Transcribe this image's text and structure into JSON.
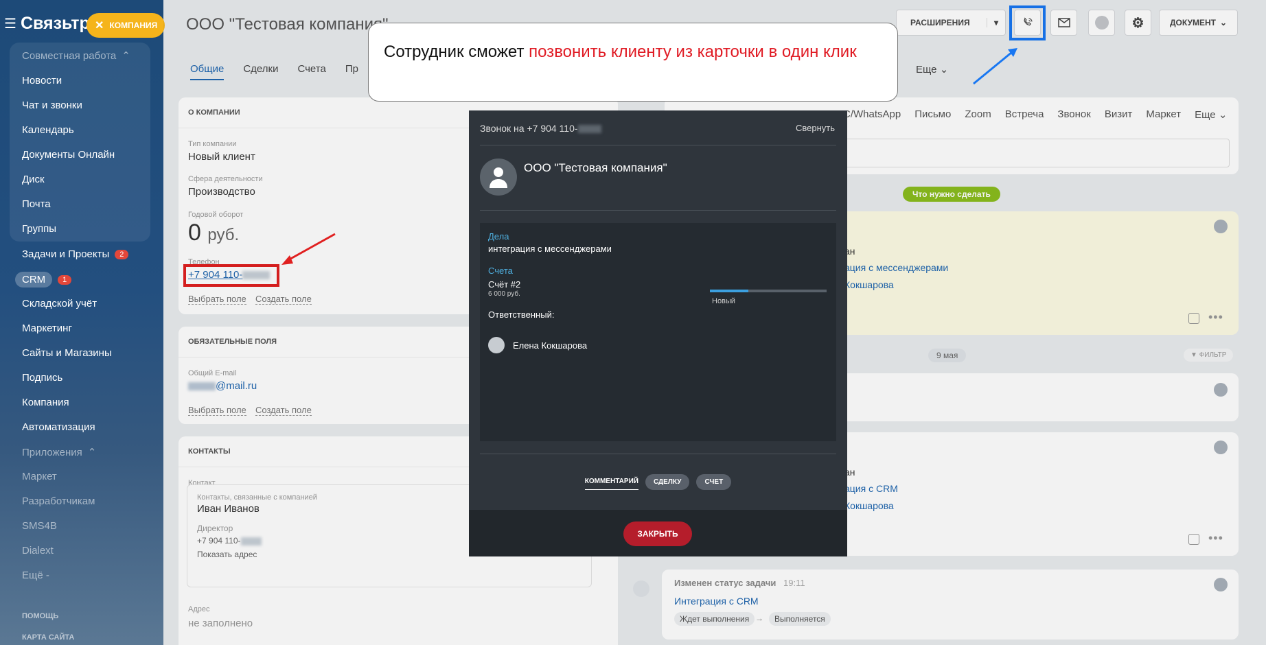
{
  "sidebar": {
    "brand": "Связьтра",
    "company_chip": "КОМПАНИЯ",
    "group_header": "Совместная работа",
    "items": [
      {
        "label": "Новости"
      },
      {
        "label": "Чат и звонки"
      },
      {
        "label": "Календарь"
      },
      {
        "label": "Документы Онлайн"
      },
      {
        "label": "Диск"
      },
      {
        "label": "Почта"
      },
      {
        "label": "Группы"
      },
      {
        "label": "Задачи и Проекты",
        "badge": "2"
      },
      {
        "label": "CRM",
        "badge": "1"
      },
      {
        "label": "Складской учёт"
      },
      {
        "label": "Маркетинг"
      },
      {
        "label": "Сайты и Магазины"
      },
      {
        "label": "Подпись"
      },
      {
        "label": "Компания"
      },
      {
        "label": "Автоматизация"
      }
    ],
    "apps_header": "Приложения",
    "apps": [
      "Маркет",
      "Разработчикам",
      "SMS4B",
      "Dialext",
      "Ещё -"
    ],
    "help": "ПОМОЩЬ",
    "sitemap": "КАРТА САЙТА"
  },
  "header": {
    "title": "ООО \"Тестовая компания\"",
    "tabs": [
      "Общие",
      "Сделки",
      "Счета",
      "Пр"
    ],
    "more_tab": "Еще",
    "buttons": {
      "extensions": "РАСШИРЕНИЯ",
      "document": "ДОКУМЕНТ"
    }
  },
  "about": {
    "heading": "О КОМПАНИИ",
    "type_label": "Тип компании",
    "type_value": "Новый клиент",
    "sphere_label": "Сфера деятельности",
    "sphere_value": "Производство",
    "revenue_label": "Годовой оборот",
    "revenue_value": "0",
    "revenue_unit": "руб.",
    "phone_label": "Телефон",
    "phone_value": "+7 904 110-",
    "choose_field": "Выбрать поле",
    "create_field": "Создать поле"
  },
  "required": {
    "heading": "ОБЯЗАТЕЛЬНЫЕ ПОЛЯ",
    "email_label": "Общий E-mail",
    "email_value": "@mail.ru",
    "choose_field": "Выбрать поле",
    "create_field": "Создать поле"
  },
  "contacts": {
    "heading": "КОНТАКТЫ",
    "contact_label": "Контакт",
    "linked_label": "Контакты, связанные с компанией",
    "name": "Иван Иванов",
    "role": "Директор",
    "phone": "+7 904 110-",
    "show_address": "Показать адрес",
    "address_label": "Адрес",
    "address_value": "не заполнено"
  },
  "timeline": {
    "activity_tabs": [
      "C/WhatsApp",
      "Письмо",
      "Zoom",
      "Встреча",
      "Звонок",
      "Визит",
      "Маркет",
      "Еще"
    ],
    "todo": "Что нужно сделать",
    "card1": {
      "line1": "ан",
      "link1": "ация с мессенджерами",
      "link2": "Кокшарова"
    },
    "date": "9 мая",
    "filter": "ФИЛЬТР",
    "card3": {
      "line1": "ан",
      "link1": "ация с CRM",
      "link2": "Кокшарова"
    },
    "status_card": {
      "title": "Изменен статус задачи",
      "time": "19:11",
      "link": "Интеграция с CRM",
      "from": "Ждет выполнения",
      "arrow": "→",
      "to": "Выполняется"
    }
  },
  "callout": {
    "text_plain": "Сотрудник сможет ",
    "text_red": "позвонить клиенту из карточки в один клик"
  },
  "call_dialog": {
    "title": "Звонок на +7 904 110-",
    "collapse": "Свернуть",
    "company": "ООО \"Тестовая компания\"",
    "deals_label": "Дела",
    "deals_value": "интеграция с мессенджерами",
    "invoices_label": "Счета",
    "invoice_name": "Счёт #2",
    "invoice_amount": "6 000 руб.",
    "invoice_status": "Новый",
    "invoice_progress": 0.33,
    "responsible_label": "Ответственный:",
    "responsible_name": "Елена Кокшарова",
    "tab_comment": "КОММЕНТАРИЙ",
    "tab_deal": "СДЕЛКУ",
    "tab_invoice": "СЧЕТ",
    "close": "ЗАКРЫТЬ"
  },
  "colors": {
    "accent": "#2067b0",
    "highlight_red": "#e02020",
    "highlight_blue": "#1877f2",
    "close_button": "#b51d2b",
    "todo_green": "#8bbd1e"
  }
}
